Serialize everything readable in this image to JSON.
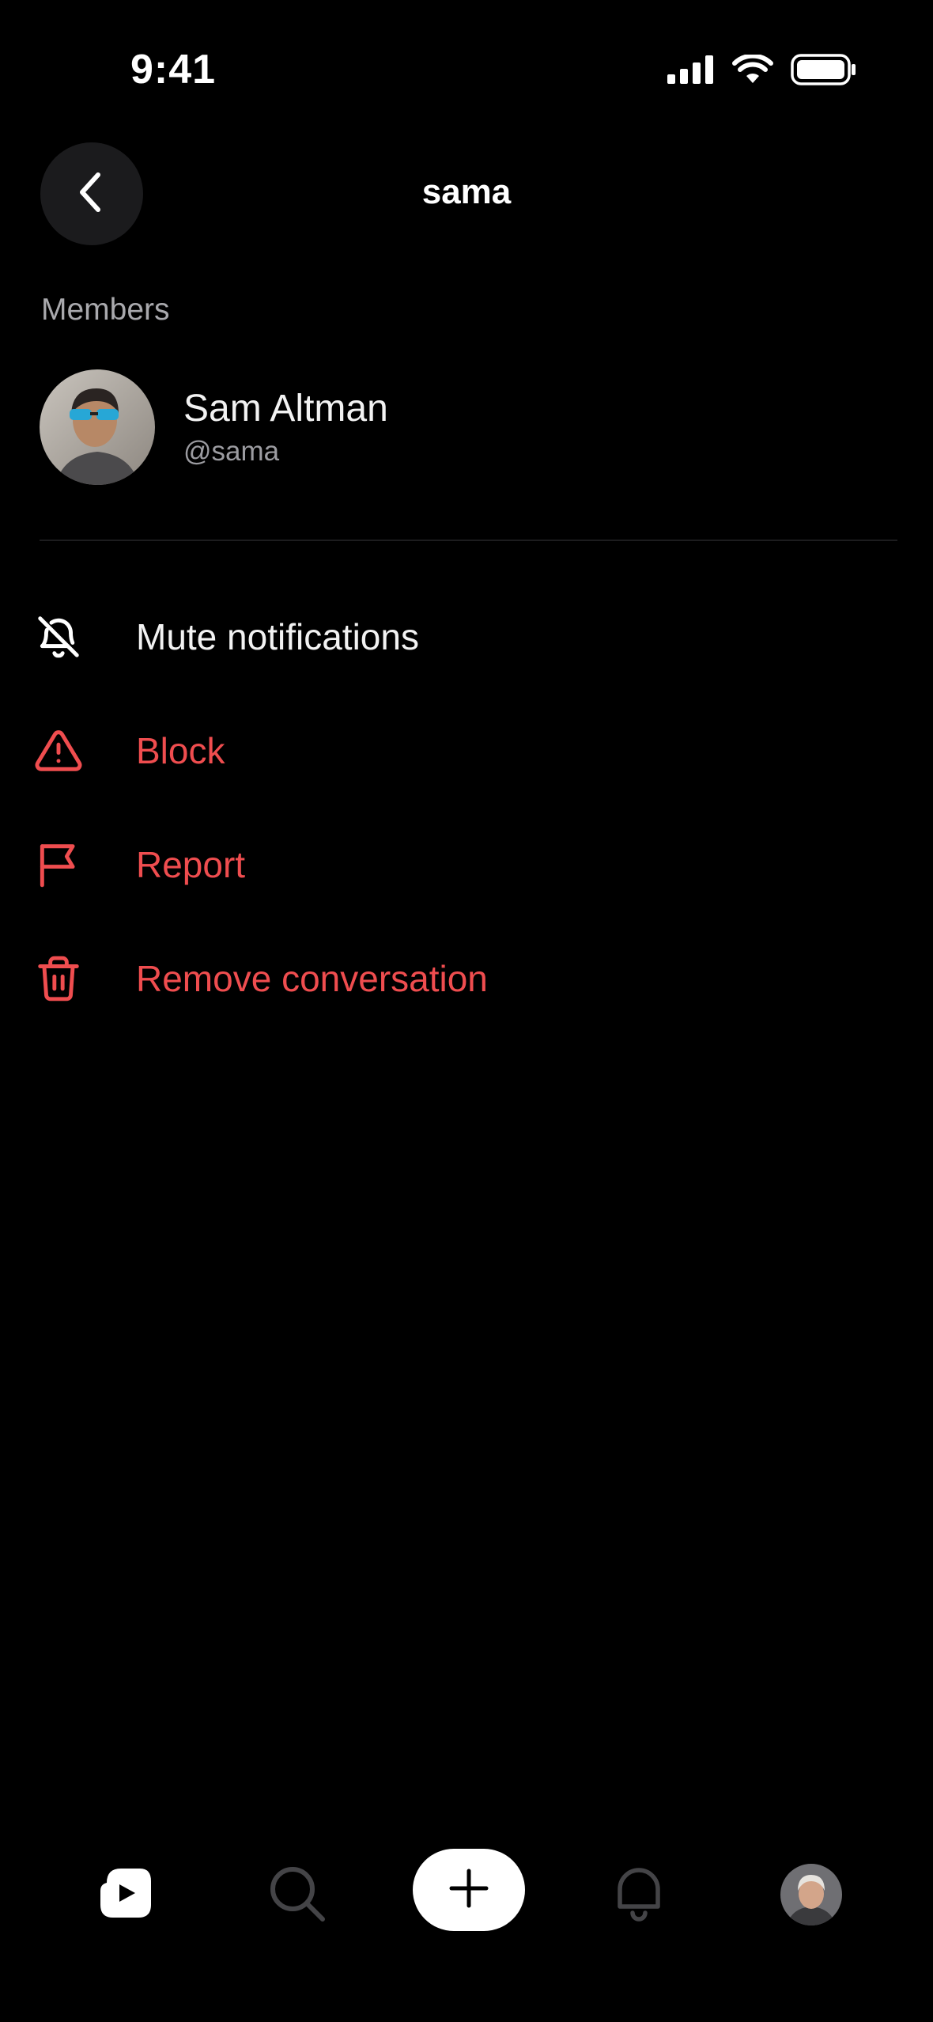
{
  "status_bar": {
    "time": "9:41",
    "icons": [
      "cellular-signal-icon",
      "wifi-icon",
      "battery-icon"
    ]
  },
  "header": {
    "back_icon": "chevron-left-icon",
    "title": "sama"
  },
  "members": {
    "section_label": "Members",
    "items": [
      {
        "name": "Sam Altman",
        "handle": "@sama",
        "avatar": "avatar-photo"
      }
    ]
  },
  "menu": {
    "items": [
      {
        "label": "Mute notifications",
        "icon": "bell-off-icon",
        "style": "normal"
      },
      {
        "label": "Block",
        "icon": "warning-triangle-icon",
        "style": "danger"
      },
      {
        "label": "Report",
        "icon": "flag-icon",
        "style": "danger"
      },
      {
        "label": "Remove conversation",
        "icon": "trash-icon",
        "style": "danger"
      }
    ]
  },
  "tab_bar": {
    "tabs": [
      {
        "name": "home",
        "icon": "play-icon",
        "active": true
      },
      {
        "name": "search",
        "icon": "search-icon",
        "active": false
      },
      {
        "name": "create",
        "icon": "plus-icon",
        "active": false
      },
      {
        "name": "notifications",
        "icon": "bell-icon",
        "active": false
      },
      {
        "name": "profile",
        "icon": "profile-avatar",
        "active": false
      }
    ]
  },
  "colors": {
    "background": "#000000",
    "danger": "#ef4d4f",
    "secondary_text": "#9c9ca1",
    "back_button_bg": "#1b1b1d",
    "create_button_bg": "#ffffff"
  }
}
